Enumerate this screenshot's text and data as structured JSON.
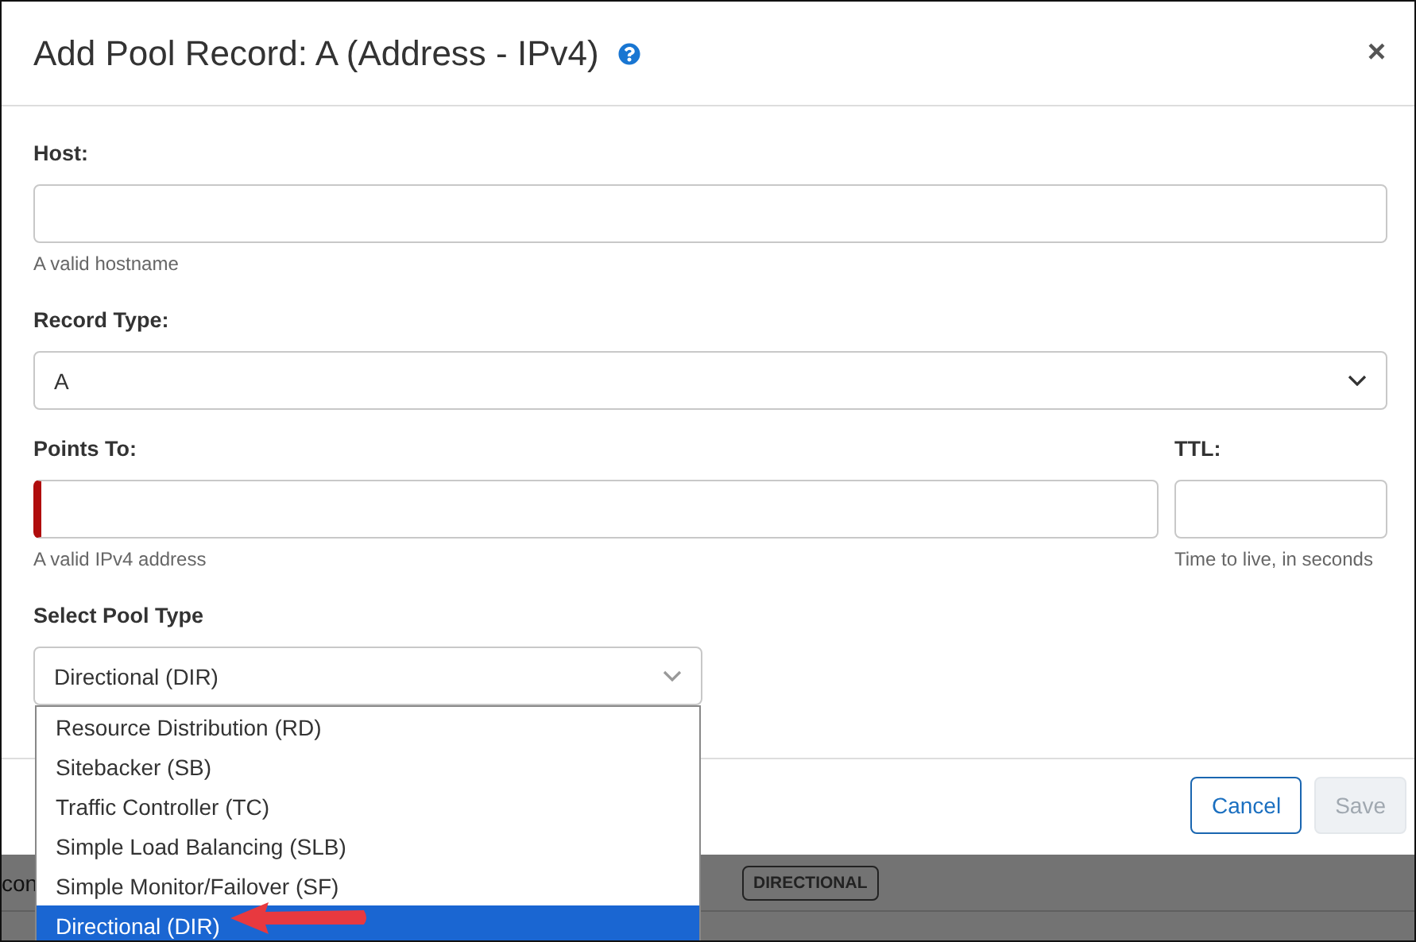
{
  "dialog": {
    "title": "Add Pool Record: A (Address - IPv4)",
    "close": "×"
  },
  "host": {
    "label": "Host:",
    "hint": "A valid hostname"
  },
  "record_type": {
    "label": "Record Type:",
    "value": "A"
  },
  "points_to": {
    "label": "Points To:",
    "hint": "A valid IPv4 address",
    "invalid": true
  },
  "ttl": {
    "label": "TTL:",
    "hint": "Time to live, in seconds"
  },
  "pool_type": {
    "label": "Select Pool Type",
    "value": "Directional (DIR)",
    "expanded": true,
    "options": [
      {
        "label": "Resource Distribution (RD)",
        "selected": false
      },
      {
        "label": "Sitebacker (SB)",
        "selected": false
      },
      {
        "label": "Traffic Controller (TC)",
        "selected": false
      },
      {
        "label": "Simple Load Balancing (SLB)",
        "selected": false
      },
      {
        "label": "Simple Monitor/Failover (SF)",
        "selected": false
      },
      {
        "label": "Directional (DIR)",
        "selected": true
      }
    ]
  },
  "buttons": [
    {
      "label": "Cancel",
      "disabled": false
    },
    {
      "label": "Save",
      "disabled": true
    }
  ],
  "background": {
    "row_text": "con",
    "badge": "DIRECTIONAL"
  }
}
